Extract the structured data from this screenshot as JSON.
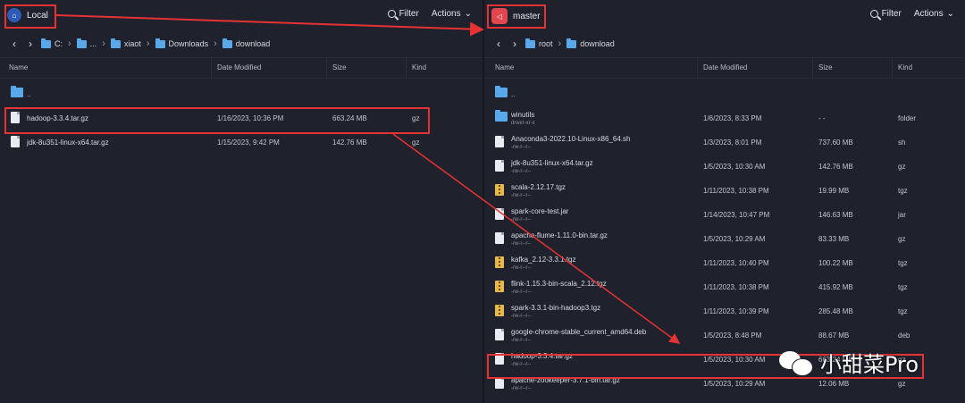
{
  "left_pane": {
    "host_label": "Local",
    "filter_label": "Filter",
    "actions_label": "Actions",
    "path": [
      "C:",
      "...",
      "xiaot",
      "Downloads",
      "download"
    ],
    "columns": [
      "Name",
      "Date Modified",
      "Size",
      "Kind"
    ],
    "rows": [
      {
        "name": "..",
        "date": "",
        "size": "",
        "kind": "",
        "icon": "folder-icon"
      },
      {
        "name": "hadoop-3.3.4.tar.gz",
        "date": "1/16/2023, 10:36 PM",
        "size": "663.24 MB",
        "kind": "gz",
        "icon": "file-icon"
      },
      {
        "name": "jdk-8u351-linux-x64.tar.gz",
        "date": "1/15/2023, 9:42 PM",
        "size": "142.76 MB",
        "kind": "gz",
        "icon": "file-icon"
      }
    ]
  },
  "right_pane": {
    "host_label": "master",
    "filter_label": "Filter",
    "actions_label": "Actions",
    "path": [
      "root",
      "download"
    ],
    "columns": [
      "Name",
      "Date Modified",
      "Size",
      "Kind"
    ],
    "rows": [
      {
        "name": "..",
        "perm": "",
        "date": "",
        "size": "",
        "kind": "",
        "icon": "folder-icon"
      },
      {
        "name": "winutils",
        "perm": "drwxr-xr-x",
        "date": "1/6/2023, 8:33 PM",
        "size": "- -",
        "kind": "folder",
        "icon": "folder-icon"
      },
      {
        "name": "Anaconda3-2022.10-Linux-x86_64.sh",
        "perm": "-rw-r--r--",
        "date": "1/3/2023, 8:01 PM",
        "size": "737.60 MB",
        "kind": "sh",
        "icon": "file-icon"
      },
      {
        "name": "jdk-8u351-linux-x64.tar.gz",
        "perm": "-rw-r--r--",
        "date": "1/5/2023, 10:30 AM",
        "size": "142.76 MB",
        "kind": "gz",
        "icon": "file-icon"
      },
      {
        "name": "scala-2.12.17.tgz",
        "perm": "-rw-r--r--",
        "date": "1/11/2023, 10:38 PM",
        "size": "19.99 MB",
        "kind": "tgz",
        "icon": "archive-icon"
      },
      {
        "name": "spark-core-test.jar",
        "perm": "-rw-r--r--",
        "date": "1/14/2023, 10:47 PM",
        "size": "146.63 MB",
        "kind": "jar",
        "icon": "file-icon"
      },
      {
        "name": "apache-flume-1.11.0-bin.tar.gz",
        "perm": "-rw-r--r--",
        "date": "1/5/2023, 10:29 AM",
        "size": "83.33 MB",
        "kind": "gz",
        "icon": "file-icon"
      },
      {
        "name": "kafka_2.12-3.3.1.tgz",
        "perm": "-rw-r--r--",
        "date": "1/11/2023, 10:40 PM",
        "size": "100.22 MB",
        "kind": "tgz",
        "icon": "archive-icon"
      },
      {
        "name": "flink-1.15.3-bin-scala_2.12.tgz",
        "perm": "-rw-r--r--",
        "date": "1/11/2023, 10:38 PM",
        "size": "415.92 MB",
        "kind": "tgz",
        "icon": "archive-icon"
      },
      {
        "name": "spark-3.3.1-bin-hadoop3.tgz",
        "perm": "-rw-r--r--",
        "date": "1/11/2023, 10:39 PM",
        "size": "285.48 MB",
        "kind": "tgz",
        "icon": "archive-icon"
      },
      {
        "name": "google-chrome-stable_current_amd64.deb",
        "perm": "-rw-r--r--",
        "date": "1/5/2023, 8:48 PM",
        "size": "88.67 MB",
        "kind": "deb",
        "icon": "file-icon"
      },
      {
        "name": "hadoop-3.3.4.tar.gz",
        "perm": "-rw-r--r--",
        "date": "1/5/2023, 10:30 AM",
        "size": "663.24 MB",
        "kind": "gz",
        "icon": "file-icon"
      },
      {
        "name": "apache-zookeeper-3.7.1-bin.tar.gz",
        "perm": "-rw-r--r--",
        "date": "1/5/2023, 10:29 AM",
        "size": "12.06 MB",
        "kind": "gz",
        "icon": "file-icon"
      }
    ]
  },
  "watermark": "小甜菜Pro",
  "colors": {
    "highlight": "#e53232",
    "folder": "#58a8ea",
    "background": "#1f212d"
  }
}
